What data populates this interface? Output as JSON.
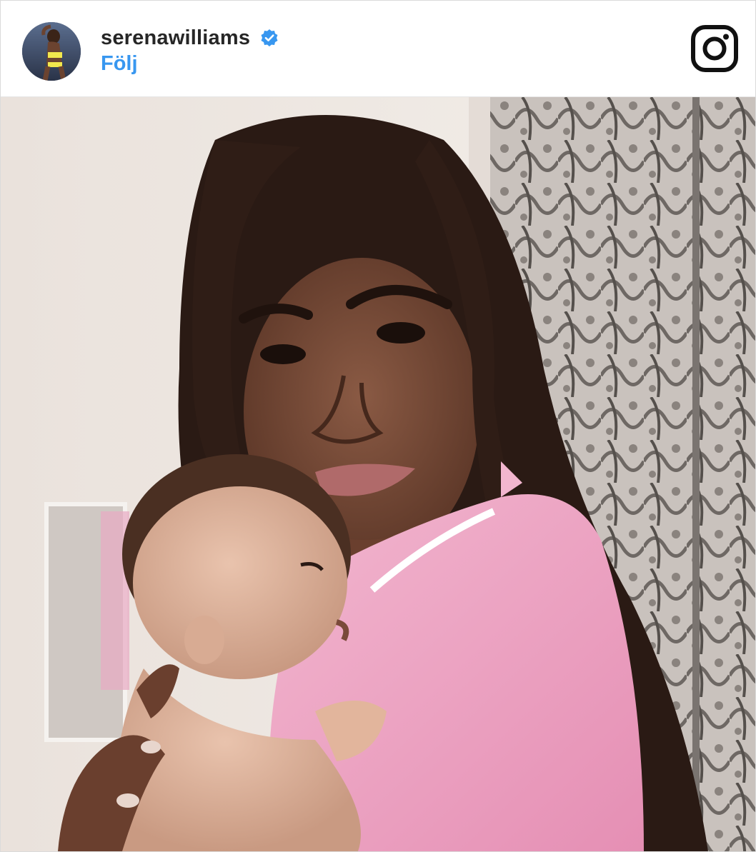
{
  "post": {
    "username": "serenawilliams",
    "verified": true,
    "follow_label": "Följ",
    "platform_icon": "instagram-icon",
    "avatar_icon": "profile-avatar",
    "photo_description_icon": "post-photo"
  },
  "colors": {
    "username": "#262626",
    "follow": "#3897f0",
    "verified_badge": "#3897f0",
    "border": "#dbdbdb"
  }
}
